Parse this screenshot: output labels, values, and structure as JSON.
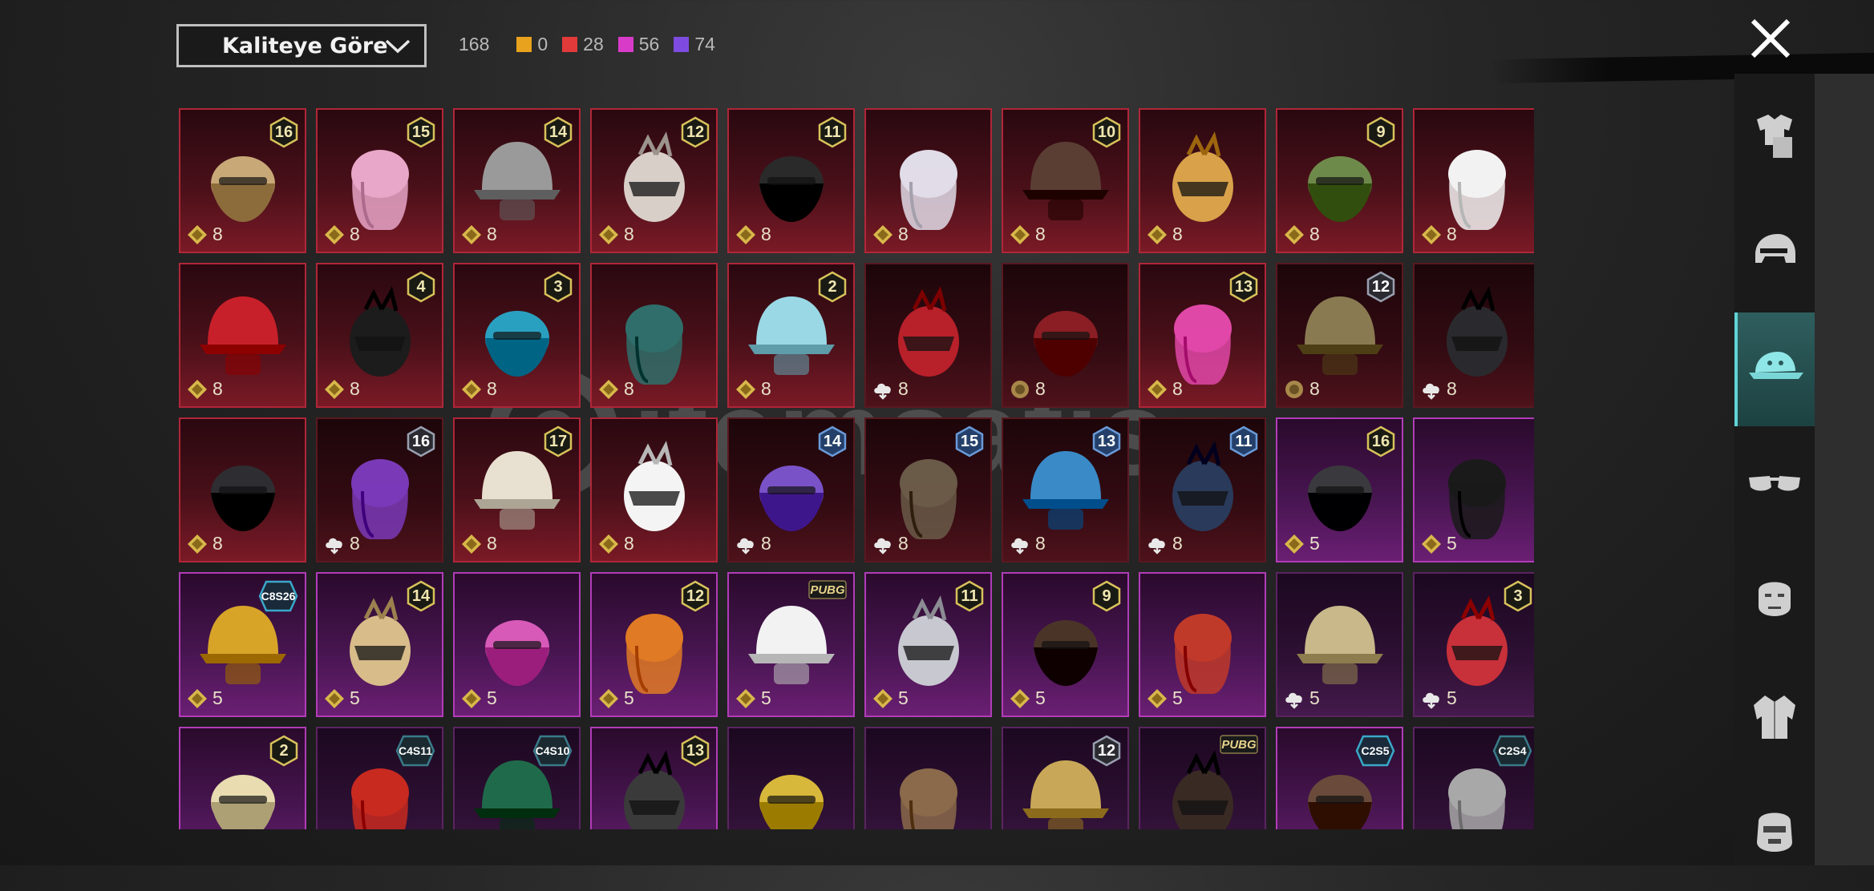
{
  "sort": {
    "label": "Kaliteye Göre"
  },
  "counts": {
    "total": "168",
    "legendary": {
      "value": "0",
      "color": "#e8a21e"
    },
    "red": {
      "value": "28",
      "color": "#e23a3a"
    },
    "magenta": {
      "value": "56",
      "color": "#d93bc9"
    },
    "purple": {
      "value": "74",
      "color": "#7e4be0"
    }
  },
  "side_tabs": [
    {
      "name": "outfit-tab",
      "icon": "outfit-icon",
      "active": false
    },
    {
      "name": "helmet-tab",
      "icon": "helmet-icon",
      "active": false
    },
    {
      "name": "hat-tab",
      "icon": "cap-icon",
      "active": true
    },
    {
      "name": "glasses-tab",
      "icon": "glasses-icon",
      "active": false
    },
    {
      "name": "face-tab",
      "icon": "face-icon",
      "active": false
    },
    {
      "name": "jacket-tab",
      "icon": "jacket-icon",
      "active": false
    },
    {
      "name": "mask-tab",
      "icon": "mask-icon",
      "active": false
    }
  ],
  "watermark": "itemsatis",
  "items": [
    {
      "badge": "16",
      "badge_type": "gold",
      "price": "8",
      "currency": "coin",
      "tier": "red",
      "color": "#c9a878"
    },
    {
      "badge": "15",
      "badge_type": "gold",
      "price": "8",
      "currency": "coin",
      "tier": "red",
      "color": "#e8a6c8"
    },
    {
      "badge": "14",
      "badge_type": "gold",
      "price": "8",
      "currency": "coin",
      "tier": "red",
      "color": "#9a9a9a"
    },
    {
      "badge": "12",
      "badge_type": "gold",
      "price": "8",
      "currency": "coin",
      "tier": "red",
      "color": "#d8cfc8"
    },
    {
      "badge": "11",
      "badge_type": "gold",
      "price": "8",
      "currency": "coin",
      "tier": "red",
      "color": "#2a2a2a"
    },
    {
      "badge": "",
      "badge_type": "",
      "price": "8",
      "currency": "coin",
      "tier": "red",
      "color": "#e0dce8"
    },
    {
      "badge": "10",
      "badge_type": "gold",
      "price": "8",
      "currency": "coin",
      "tier": "red",
      "color": "#5a3e34"
    },
    {
      "badge": "",
      "badge_type": "",
      "price": "8",
      "currency": "coin",
      "tier": "red",
      "color": "#d9a24a"
    },
    {
      "badge": "9",
      "badge_type": "gold",
      "price": "8",
      "currency": "coin",
      "tier": "red",
      "color": "#6e8a4a"
    },
    {
      "badge": "",
      "badge_type": "",
      "price": "8",
      "currency": "coin",
      "tier": "red",
      "color": "#f2f2f2"
    },
    {
      "badge": "",
      "badge_type": "",
      "price": "8",
      "currency": "coin",
      "tier": "red",
      "color": "#c8202a"
    },
    {
      "badge": "4",
      "badge_type": "gold",
      "price": "8",
      "currency": "coin",
      "tier": "red",
      "color": "#1c1c1c"
    },
    {
      "badge": "3",
      "badge_type": "gold",
      "price": "8",
      "currency": "coin",
      "tier": "red",
      "color": "#2aa0c0"
    },
    {
      "badge": "",
      "badge_type": "",
      "price": "8",
      "currency": "coin",
      "tier": "red",
      "color": "#2f6e6a"
    },
    {
      "badge": "2",
      "badge_type": "gold",
      "price": "8",
      "currency": "coin",
      "tier": "red",
      "color": "#9ad8e6"
    },
    {
      "badge": "",
      "badge_type": "",
      "price": "8",
      "currency": "cloud",
      "tier": "red-dark",
      "color": "#b8202a"
    },
    {
      "badge": "",
      "badge_type": "",
      "price": "8",
      "currency": "medal",
      "tier": "red-dark",
      "color": "#8a1e24"
    },
    {
      "badge": "13",
      "badge_type": "gold",
      "price": "8",
      "currency": "coin",
      "tier": "red",
      "color": "#e048a8"
    },
    {
      "badge": "12",
      "badge_type": "silver",
      "price": "8",
      "currency": "medal",
      "tier": "red-dark",
      "color": "#8a7a52"
    },
    {
      "badge": "",
      "badge_type": "",
      "price": "8",
      "currency": "cloud",
      "tier": "red-dark",
      "color": "#2a2a2e"
    },
    {
      "badge": "",
      "badge_type": "",
      "price": "8",
      "currency": "coin",
      "tier": "red",
      "color": "#2e2e32"
    },
    {
      "badge": "16",
      "badge_type": "silver",
      "price": "8",
      "currency": "cloud",
      "tier": "red-dark",
      "color": "#7a3ab8"
    },
    {
      "badge": "17",
      "badge_type": "gold",
      "price": "8",
      "currency": "coin",
      "tier": "red",
      "color": "#e8e0d0"
    },
    {
      "badge": "",
      "badge_type": "",
      "price": "8",
      "currency": "coin",
      "tier": "red",
      "color": "#f4f4f4"
    },
    {
      "badge": "14",
      "badge_type": "blue",
      "price": "8",
      "currency": "cloud",
      "tier": "red-dark",
      "color": "#7a52c8"
    },
    {
      "badge": "15",
      "badge_type": "blue",
      "price": "8",
      "currency": "cloud",
      "tier": "red-dark",
      "color": "#6a5a48"
    },
    {
      "badge": "13",
      "badge_type": "blue",
      "price": "8",
      "currency": "cloud",
      "tier": "red-dark",
      "color": "#3a8ac8"
    },
    {
      "badge": "11",
      "badge_type": "blue",
      "price": "8",
      "currency": "cloud",
      "tier": "red-dark",
      "color": "#2a3a5a"
    },
    {
      "badge": "16",
      "badge_type": "gold",
      "price": "5",
      "currency": "coin",
      "tier": "purple",
      "color": "#3a3a3e"
    },
    {
      "badge": "",
      "badge_type": "",
      "price": "5",
      "currency": "coin",
      "tier": "purple",
      "color": "#1a1a1a"
    },
    {
      "badge": "C8S26",
      "badge_type": "season",
      "price": "5",
      "currency": "coin",
      "tier": "purple",
      "color": "#d8a428"
    },
    {
      "badge": "14",
      "badge_type": "gold",
      "price": "5",
      "currency": "coin",
      "tier": "purple",
      "color": "#d8bc8a"
    },
    {
      "badge": "",
      "badge_type": "",
      "price": "5",
      "currency": "coin",
      "tier": "purple",
      "color": "#d85ab8"
    },
    {
      "badge": "12",
      "badge_type": "gold",
      "price": "5",
      "currency": "coin",
      "tier": "purple",
      "color": "#e07a24"
    },
    {
      "badge": "PUBG",
      "badge_type": "tag",
      "price": "5",
      "currency": "coin",
      "tier": "purple",
      "color": "#f2f2f2"
    },
    {
      "badge": "11",
      "badge_type": "gold",
      "price": "5",
      "currency": "coin",
      "tier": "purple",
      "color": "#c8c8d0"
    },
    {
      "badge": "9",
      "badge_type": "gold",
      "price": "5",
      "currency": "coin",
      "tier": "purple",
      "color": "#4a3428"
    },
    {
      "badge": "",
      "badge_type": "",
      "price": "5",
      "currency": "coin",
      "tier": "purple",
      "color": "#c03a2a"
    },
    {
      "badge": "",
      "badge_type": "",
      "price": "5",
      "currency": "cloud",
      "tier": "purple-dark",
      "color": "#c8b88a"
    },
    {
      "badge": "3",
      "badge_type": "gold",
      "price": "5",
      "currency": "cloud",
      "tier": "purple-dark",
      "color": "#c8303a"
    },
    {
      "badge": "2",
      "badge_type": "gold",
      "price": "",
      "currency": "",
      "tier": "purple",
      "color": "#e8dcb0"
    },
    {
      "badge": "C4S11",
      "badge_type": "season-dark",
      "price": "",
      "currency": "",
      "tier": "purple-dark",
      "color": "#c82a20"
    },
    {
      "badge": "C4S10",
      "badge_type": "season-dark",
      "price": "",
      "currency": "",
      "tier": "purple-dark",
      "color": "#1f6a4a"
    },
    {
      "badge": "13",
      "badge_type": "gold",
      "price": "",
      "currency": "",
      "tier": "purple",
      "color": "#3a3a3a"
    },
    {
      "badge": "",
      "badge_type": "",
      "price": "",
      "currency": "",
      "tier": "purple-dark",
      "color": "#d8b83a"
    },
    {
      "badge": "",
      "badge_type": "",
      "price": "",
      "currency": "",
      "tier": "purple-dark",
      "color": "#8a6a4a"
    },
    {
      "badge": "12",
      "badge_type": "silver",
      "price": "",
      "currency": "",
      "tier": "purple-dark",
      "color": "#c8a858"
    },
    {
      "badge": "PUBG",
      "badge_type": "tag",
      "price": "",
      "currency": "",
      "tier": "purple-dark",
      "color": "#3a2a24"
    },
    {
      "badge": "C2S5",
      "badge_type": "season",
      "price": "",
      "currency": "",
      "tier": "purple",
      "color": "#6a4a3a"
    },
    {
      "badge": "C2S4",
      "badge_type": "season-dark",
      "price": "",
      "currency": "",
      "tier": "purple-dark",
      "color": "#a8a8a8"
    }
  ]
}
